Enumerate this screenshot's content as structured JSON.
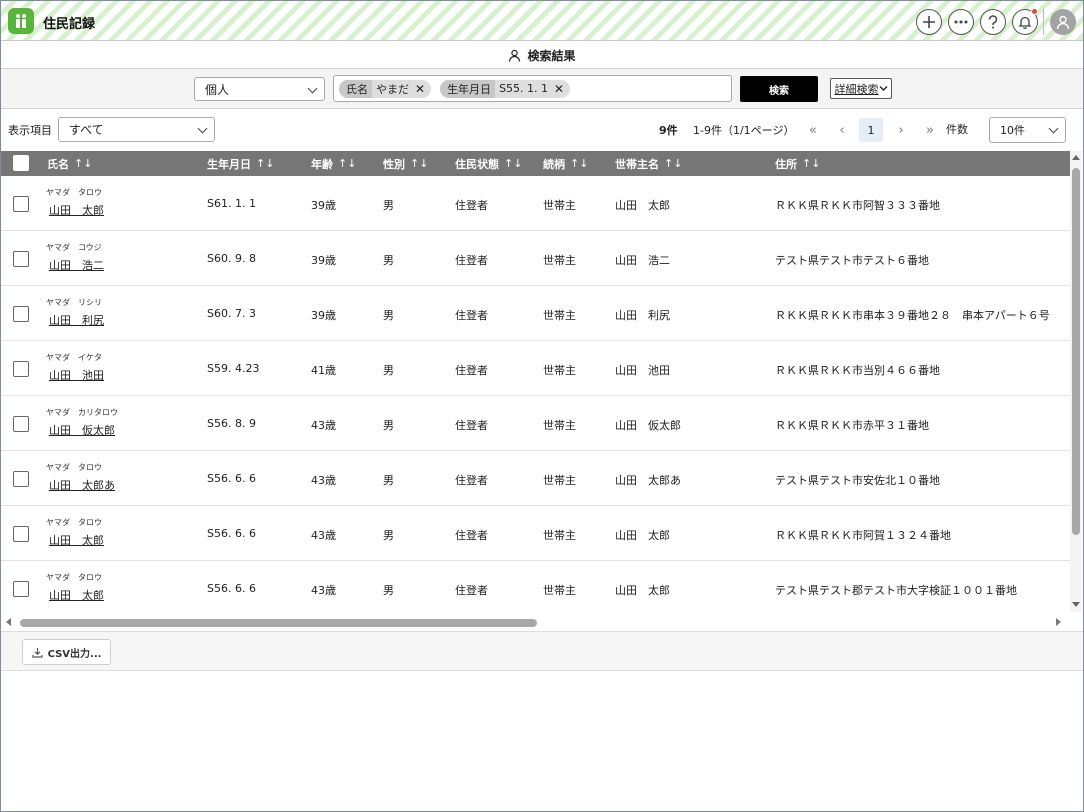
{
  "app": {
    "title": "住民記録"
  },
  "header": {
    "subtitle": "検索結果"
  },
  "search": {
    "mode": "個人",
    "chips": [
      {
        "key": "氏名",
        "value": "やまだ"
      },
      {
        "key": "生年月日",
        "value": "S55. 1. 1"
      }
    ],
    "search_label": "検索",
    "advanced_label": "詳細検索"
  },
  "display": {
    "label": "表示項目",
    "value": "すべて"
  },
  "pagination": {
    "count": "9件",
    "range": "1-9件（1/1ページ）",
    "current_page": "1",
    "per_page_label": "件数",
    "per_page": "10件"
  },
  "table": {
    "columns": [
      "氏名",
      "生年月日",
      "年齢",
      "性別",
      "住民状態",
      "続柄",
      "世帯主名",
      "住所"
    ],
    "rows": [
      {
        "kana": "ヤマダ　タロウ",
        "name": "山田　太郎",
        "birth": "S61. 1. 1",
        "age": "39歳",
        "sex": "男",
        "status": "住登者",
        "relation": "世帯主",
        "head": "山田　太郎",
        "address": "ＲＫＫ県ＲＫＫ市阿智３３３番地"
      },
      {
        "kana": "ヤマダ　コウジ",
        "name": "山田　浩二",
        "birth": "S60. 9. 8",
        "age": "39歳",
        "sex": "男",
        "status": "住登者",
        "relation": "世帯主",
        "head": "山田　浩二",
        "address": "テスト県テスト市テスト６番地"
      },
      {
        "kana": "ヤマダ　リシリ",
        "name": "山田　利尻",
        "birth": "S60. 7. 3",
        "age": "39歳",
        "sex": "男",
        "status": "住登者",
        "relation": "世帯主",
        "head": "山田　利尻",
        "address": "ＲＫＫ県ＲＫＫ市串本３９番地２８　串本アパート６号"
      },
      {
        "kana": "ヤマダ　イケタ",
        "name": "山田　池田",
        "birth": "S59. 4.23",
        "age": "41歳",
        "sex": "男",
        "status": "住登者",
        "relation": "世帯主",
        "head": "山田　池田",
        "address": "ＲＫＫ県ＲＫＫ市当別４６６番地"
      },
      {
        "kana": "ヤマダ　カリタロウ",
        "name": "山田　仮太郎",
        "birth": "S56. 8. 9",
        "age": "43歳",
        "sex": "男",
        "status": "住登者",
        "relation": "世帯主",
        "head": "山田　仮太郎",
        "address": "ＲＫＫ県ＲＫＫ市赤平３１番地"
      },
      {
        "kana": "ヤマダ　タロウ",
        "name": "山田　太郎あ",
        "birth": "S56. 6. 6",
        "age": "43歳",
        "sex": "男",
        "status": "住登者",
        "relation": "世帯主",
        "head": "山田　太郎あ",
        "address": "テスト県テスト市安佐北１０番地"
      },
      {
        "kana": "ヤマダ　タロウ",
        "name": "山田　太郎",
        "birth": "S56. 6. 6",
        "age": "43歳",
        "sex": "男",
        "status": "住登者",
        "relation": "世帯主",
        "head": "山田　太郎",
        "address": "ＲＫＫ県ＲＫＫ市阿賀１３２４番地"
      },
      {
        "kana": "ヤマダ　タロウ",
        "name": "山田　太郎",
        "birth": "S56. 6. 6",
        "age": "43歳",
        "sex": "男",
        "status": "住登者",
        "relation": "世帯主",
        "head": "山田　太郎",
        "address": "テスト県テスト郡テスト市大字検証１００１番地"
      }
    ]
  },
  "footer": {
    "csv_label": "CSV出力..."
  },
  "colors": {
    "accent_green": "#5ab53d",
    "header_stripe": "#d7f1cf",
    "table_header": "#767676",
    "notification_dot": "#e0443a"
  },
  "icons": [
    "logo-people-icon",
    "plus-icon",
    "more-icon",
    "help-icon",
    "bell-icon",
    "user-avatar-icon",
    "person-icon",
    "chevron-down-icon",
    "close-icon",
    "sort-icon",
    "first-page-icon",
    "prev-page-icon",
    "next-page-icon",
    "last-page-icon",
    "download-icon"
  ]
}
